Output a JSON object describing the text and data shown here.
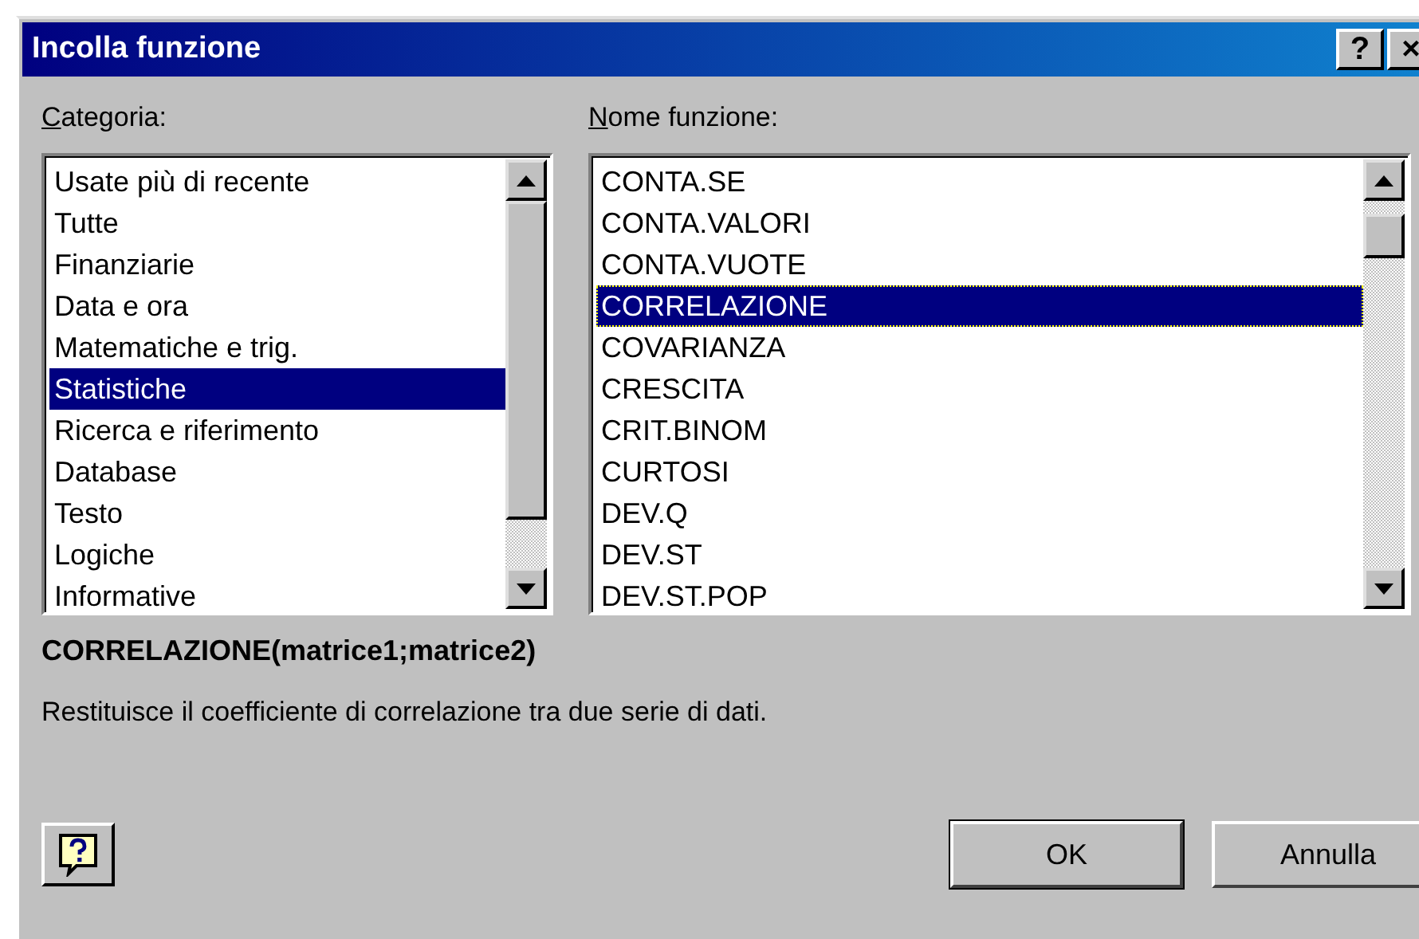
{
  "window": {
    "title": "Incolla funzione",
    "title_buttons": [
      "?",
      "×"
    ]
  },
  "category_list": {
    "label": "Categoria:",
    "items": [
      {
        "text": "Usate più di recente",
        "selected": false
      },
      {
        "text": "Tutte",
        "selected": false
      },
      {
        "text": "Finanziarie",
        "selected": false
      },
      {
        "text": "Data e ora",
        "selected": false
      },
      {
        "text": "Matematiche e trig.",
        "selected": false
      },
      {
        "text": "Statistiche",
        "selected": true
      },
      {
        "text": "Ricerca e riferimento",
        "selected": false
      },
      {
        "text": "Database",
        "selected": false
      },
      {
        "text": "Testo",
        "selected": false
      },
      {
        "text": "Logiche",
        "selected": false
      },
      {
        "text": "Informative",
        "selected": false
      }
    ]
  },
  "function_list": {
    "label": "Nome funzione:",
    "items": [
      {
        "text": "CONTA.SE",
        "selected": false
      },
      {
        "text": "CONTA.VALORI",
        "selected": false
      },
      {
        "text": "CONTA.VUOTE",
        "selected": false
      },
      {
        "text": "CORRELAZIONE",
        "selected": true
      },
      {
        "text": "COVARIANZA",
        "selected": false
      },
      {
        "text": "CRESCITA",
        "selected": false
      },
      {
        "text": "CRIT.BINOM",
        "selected": false
      },
      {
        "text": "CURTOSI",
        "selected": false
      },
      {
        "text": "DEV.Q",
        "selected": false
      },
      {
        "text": "DEV.ST",
        "selected": false
      },
      {
        "text": "DEV.ST.POP",
        "selected": false
      }
    ]
  },
  "signature": "CORRELAZIONE(matrice1;matrice2)",
  "description": "Restituisce il coefficiente di correlazione tra due serie di dati.",
  "buttons": [
    "OK",
    "Annulla"
  ]
}
